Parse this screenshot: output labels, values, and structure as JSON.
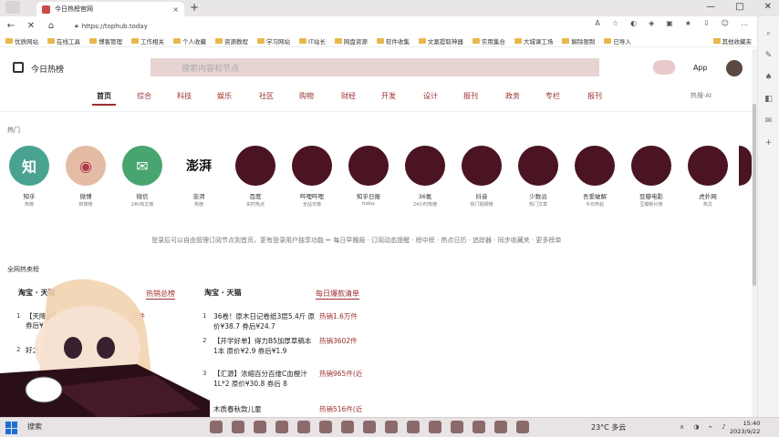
{
  "browser": {
    "tab_title": "今日热榜官网",
    "tab_close": "×",
    "new_tab": "+",
    "url": "https://tophub.today",
    "window_controls": [
      "—",
      "□",
      "✕"
    ]
  },
  "bookmarks": [
    "优质网站",
    "在线工具",
    "博客管理",
    "工作相关",
    "个人收藏",
    "资源教程",
    "学习网站",
    "IT站长",
    "网盘资源",
    "软件收集",
    "文案提取神器",
    "实用集合",
    "大城课工场",
    "解除限制",
    "已导入"
  ],
  "bookmarks_other": "其他收藏夹",
  "site": {
    "name": "今日热榜",
    "search_placeholder": "搜索内容和节点",
    "app_label": "App",
    "categories": [
      "首页",
      "综合",
      "科技",
      "娱乐",
      "社区",
      "购物",
      "财经",
      "开发",
      "设计",
      "报刊",
      "政务",
      "专栏",
      "报刊"
    ],
    "ai_label": "热搜·AI",
    "hot_title": "热门",
    "platforms": [
      {
        "name": "知乎",
        "sub": "热榜",
        "icon": "知"
      },
      {
        "name": "微博",
        "sub": "热搜榜",
        "icon": "◉"
      },
      {
        "name": "微信",
        "sub": "24h热文榜",
        "icon": "✉"
      },
      {
        "name": "澎湃",
        "sub": "热榜",
        "icon": "澎湃"
      },
      {
        "name": "百度",
        "sub": "实时热点",
        "icon": ""
      },
      {
        "name": "哔哩哔哩",
        "sub": "全站日榜",
        "icon": ""
      },
      {
        "name": "知乎日报",
        "sub": "today",
        "icon": ""
      },
      {
        "name": "36氪",
        "sub": "24小时热榜",
        "icon": ""
      },
      {
        "name": "抖音",
        "sub": "热门视频榜",
        "icon": ""
      },
      {
        "name": "少数派",
        "sub": "热门文章",
        "icon": ""
      },
      {
        "name": "吾爱破解",
        "sub": "今日热帖",
        "icon": ""
      },
      {
        "name": "豆瓣电影",
        "sub": "豆瓣新片榜",
        "icon": ""
      },
      {
        "name": "虎扑网",
        "sub": "热文",
        "icon": ""
      }
    ],
    "login_tip": "登录后可以自由管理订阅节点到首页，更有登录用户独享功能 ✏ 每日早晚报 · 订阅动态提醒 · 榜中榜 · 热点日历 · 追踪器 · 同步收藏夹 · 更多榜单",
    "net_title": "全网热卖榜",
    "panels": [
      {
        "head": "淘宝 · 天猫",
        "tab": "热销总榜",
        "items": [
          {
            "rank": "1",
            "text": "【天降剑】… 纯棉洗脸…",
            "sold": "万件"
          },
          {
            "rank": "",
            "text": "券后¥3.…",
            "sold": ""
          },
          {
            "rank": "2",
            "text": "好之…",
            "sold": ""
          }
        ]
      },
      {
        "head": "淘宝 · 天猫",
        "tab": "每日爆款清单",
        "items": [
          {
            "rank": "1",
            "text": "36卷！原木日记卷纸3层5.4斤 原价¥38.7 券后¥24.7",
            "sold": "热销1.6万件"
          },
          {
            "rank": "2",
            "text": "【开学好单】得力B5加厚草稿本1本 原价¥2.9 券后¥1.9",
            "sold": "热销3602件"
          },
          {
            "rank": "3",
            "text": "【汇源】浓缩百分百维C血橙汁1L*2 原价¥30.8 券后 8",
            "sold": "热销965件(近"
          },
          {
            "rank": "4",
            "text": "木质春秋款儿童",
            "sold": "热销516件(近"
          }
        ]
      }
    ]
  },
  "taskbar": {
    "search": "搜索",
    "weather": "23°C 多云",
    "time": "15:40",
    "date": "2023/9/22"
  }
}
